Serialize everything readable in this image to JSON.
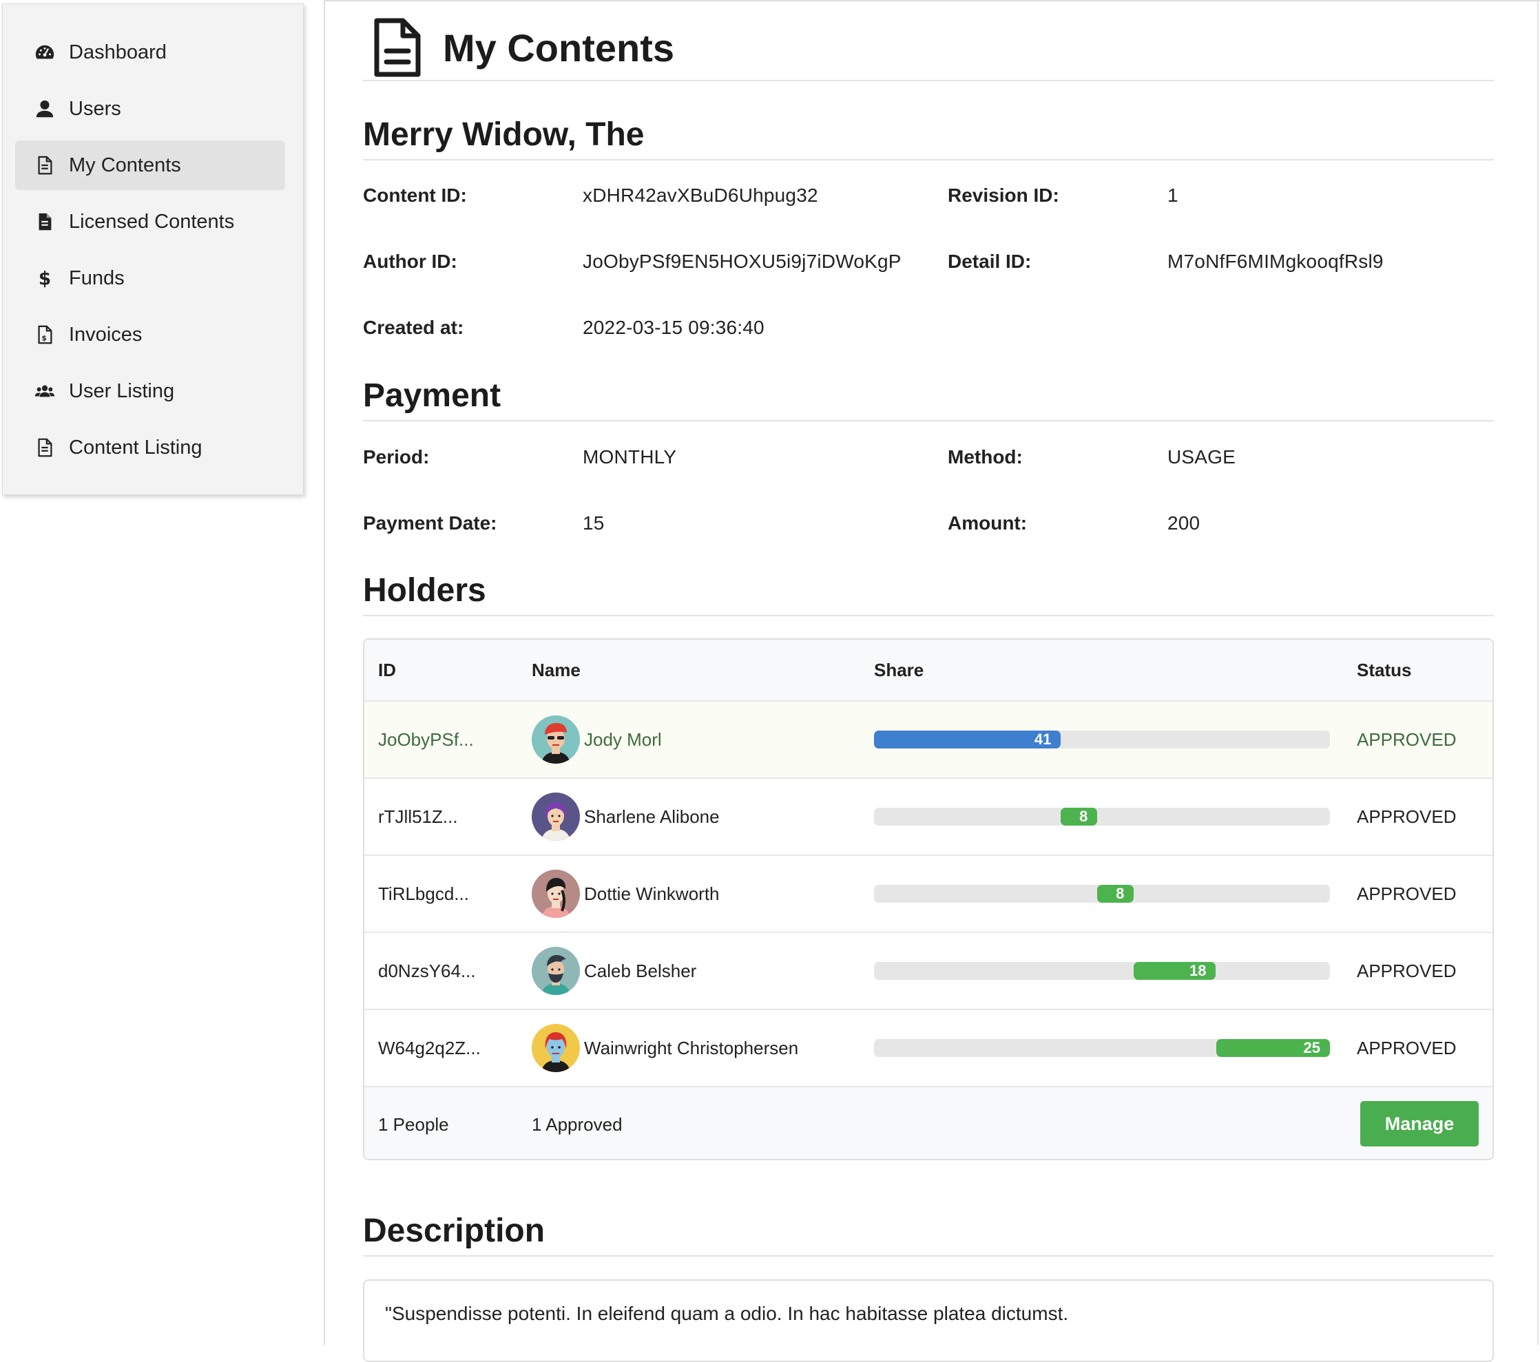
{
  "sidebar": {
    "items": [
      {
        "label": "Dashboard",
        "icon": "gauge-icon"
      },
      {
        "label": "Users",
        "icon": "user-icon"
      },
      {
        "label": "My Contents",
        "icon": "file-icon",
        "active": true
      },
      {
        "label": "Licensed Contents",
        "icon": "file-solid-icon"
      },
      {
        "label": "Funds",
        "icon": "dollar-icon"
      },
      {
        "label": "Invoices",
        "icon": "invoice-icon"
      },
      {
        "label": "User Listing",
        "icon": "users-group-icon"
      },
      {
        "label": "Content Listing",
        "icon": "file-icon"
      }
    ]
  },
  "page": {
    "title": "My Contents"
  },
  "content": {
    "title": "Merry Widow, The",
    "content_id_label": "Content ID:",
    "content_id": "xDHR42avXBuD6Uhpug32",
    "revision_id_label": "Revision ID:",
    "revision_id": "1",
    "author_id_label": "Author ID:",
    "author_id": "JoObyPSf9EN5HOXU5i9j7iDWoKgP",
    "detail_id_label": "Detail ID:",
    "detail_id": "M7oNfF6MIMgkooqfRsl9",
    "created_at_label": "Created at:",
    "created_at": "2022-03-15 09:36:40"
  },
  "payment": {
    "title": "Payment",
    "period_label": "Period:",
    "period": "MONTHLY",
    "method_label": "Method:",
    "method": "USAGE",
    "payment_date_label": "Payment Date:",
    "payment_date": "15",
    "amount_label": "Amount:",
    "amount": "200"
  },
  "holders": {
    "title": "Holders",
    "columns": [
      "ID",
      "Name",
      "Share",
      "Status"
    ],
    "rows": [
      {
        "id": "JoObyPSf...",
        "name": "Jody Morl",
        "share": 41,
        "offset": 0,
        "color": "#3f7fcf",
        "status": "APPROVED",
        "highlight": true
      },
      {
        "id": "rTJll51Z...",
        "name": "Sharlene Alibone",
        "share": 8,
        "offset": 41,
        "color": "#4cb34e",
        "status": "APPROVED"
      },
      {
        "id": "TiRLbgcd...",
        "name": "Dottie Winkworth",
        "share": 8,
        "offset": 49,
        "color": "#4cb34e",
        "status": "APPROVED"
      },
      {
        "id": "d0NzsY64...",
        "name": "Caleb Belsher",
        "share": 18,
        "offset": 57,
        "color": "#4cb34e",
        "status": "APPROVED"
      },
      {
        "id": "W64g2q2Z...",
        "name": "Wainwright Christophersen",
        "share": 25,
        "offset": 75,
        "color": "#4cb34e",
        "status": "APPROVED"
      }
    ],
    "footer": {
      "people": "1 People",
      "approved": "1 Approved",
      "manage_label": "Manage"
    }
  },
  "description": {
    "title": "Description",
    "text": "\"Suspendisse potenti. In eleifend quam a odio. In hac habitasse platea dictumst."
  }
}
